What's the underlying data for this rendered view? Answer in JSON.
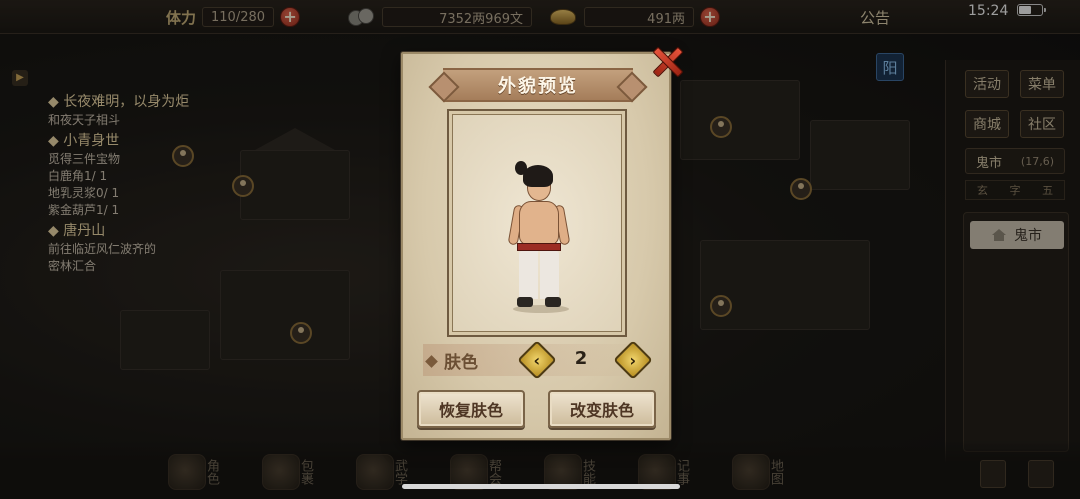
{
  "status_bar": {
    "stamina_label": "体力",
    "stamina_value": "110/280",
    "coins_value": "7352两969文",
    "gold_value": "491两",
    "notice_label": "公告",
    "clock": "15:24"
  },
  "quests": [
    {
      "title": "长夜难明，以身为炬",
      "lines": [
        "和夜天子相斗"
      ]
    },
    {
      "title": "小青身世",
      "lines": [
        "觅得三件宝物",
        "白鹿角1/ 1",
        "地乳灵浆0/ 1",
        "紫金葫芦1/ 1"
      ]
    },
    {
      "title": "唐丹山",
      "lines": [
        "前往临近风仁波齐的",
        "密林汇合"
      ]
    }
  ],
  "yang_badge": "阳",
  "side_menu": {
    "buttons": [
      "活动",
      "菜单",
      "商城",
      "社区"
    ],
    "area_name": "鬼市",
    "area_level": "(17,6)",
    "tier_labels": [
      "玄",
      "字",
      "五"
    ],
    "list_items": [
      "鬼市"
    ]
  },
  "bottom_nav": [
    {
      "label": "角色",
      "icon": "character-icon"
    },
    {
      "label": "包裹",
      "icon": "bag-icon"
    },
    {
      "label": "武学",
      "icon": "martial-arts-icon"
    },
    {
      "label": "帮会",
      "icon": "guild-icon"
    },
    {
      "label": "技能",
      "icon": "skill-icon"
    },
    {
      "label": "记事",
      "icon": "journal-icon"
    },
    {
      "label": "地图",
      "icon": "map-icon"
    }
  ],
  "modal": {
    "title": "外貌预览",
    "skin_label": "肤色",
    "skin_value": "2",
    "prev_symbol": "‹",
    "next_symbol": "›",
    "restore_button": "恢复肤色",
    "change_button": "改变肤色"
  },
  "colors": {
    "accent_red": "#c23a24",
    "parchment": "#d7c9ab",
    "title_banner": "#b38c69"
  }
}
